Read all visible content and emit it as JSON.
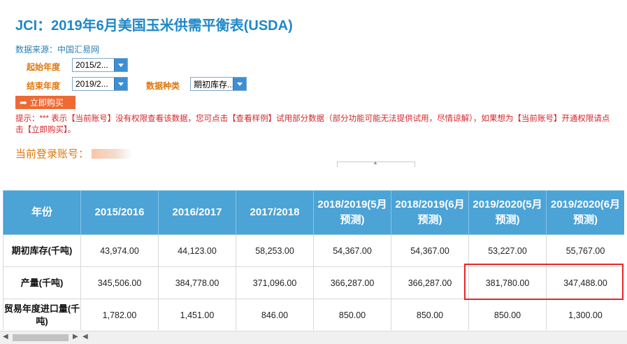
{
  "header": {
    "title": "JCI：2019年6月美国玉米供需平衡表(USDA)",
    "source": "数据来源：中国汇易网"
  },
  "filters": {
    "start_label": "起始年度",
    "start_value": "2015/2...",
    "end_label": "结束年度",
    "end_value": "2019/2...",
    "type_label": "数据种类",
    "type_value": "期初库存..."
  },
  "buy_button": {
    "label": "立即购买"
  },
  "notice": "提示：*** 表示【当前账号】没有权限查看该数据，您可点击【查看样例】试用部分数据（部分功能可能无法提供试用，尽情谅解），如果想为【当前账号】开通权限请点击【立即购买】。",
  "account": {
    "label": "当前登录账号："
  },
  "table": {
    "columns": [
      "年份",
      "2015/2016",
      "2016/2017",
      "2017/2018",
      "2018/2019(5月预测)",
      "2018/2019(6月预测)",
      "2019/2020(5月预测)",
      "2019/2020(6月预测)"
    ],
    "rows": [
      {
        "label": "期初库存(千吨)",
        "values": [
          "43,974.00",
          "44,123.00",
          "58,253.00",
          "54,367.00",
          "54,367.00",
          "53,227.00",
          "55,767.00"
        ]
      },
      {
        "label": "产量(千吨)",
        "values": [
          "345,506.00",
          "384,778.00",
          "371,096.00",
          "366,287.00",
          "366,287.00",
          "381,780.00",
          "347,488.00"
        ]
      },
      {
        "label": "贸易年度进口量(千吨)",
        "values": [
          "1,782.00",
          "1,451.00",
          "846.00",
          "850.00",
          "850.00",
          "850.00",
          "1,300.00"
        ]
      }
    ]
  },
  "colors": {
    "title": "#1e88c8",
    "header_bg": "#4ba3d6",
    "notice": "#d6262b",
    "label": "#e0760a",
    "button": "#ee6a35",
    "highlight": "#e82624"
  }
}
